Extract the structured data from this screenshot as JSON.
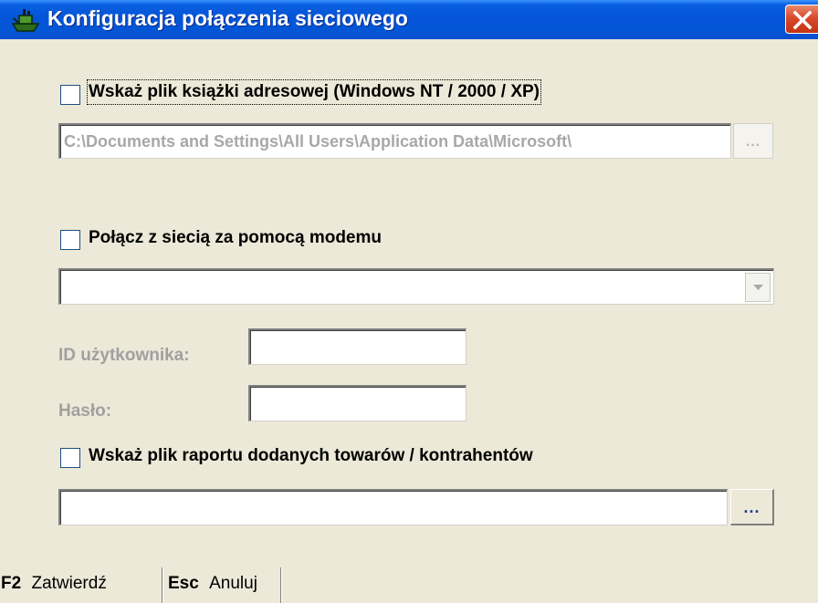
{
  "window": {
    "title": "Konfiguracja połączenia sieciowego",
    "close_glyph": "✕"
  },
  "address_book": {
    "checkbox_label": "Wskaż plik książki adresowej (Windows NT / 2000 / XP)",
    "checked": false,
    "path_value": "C:\\Documents and Settings\\All Users\\Application Data\\Microsoft\\",
    "browse_label": "..."
  },
  "modem": {
    "checkbox_label": "Połącz z siecią za pomocą modemu",
    "checked": false,
    "selected_connection": ""
  },
  "credentials": {
    "user_id_label": "ID użytkownika:",
    "user_id_value": "",
    "password_label": "Hasło:",
    "password_value": ""
  },
  "report": {
    "checkbox_label": "Wskaż plik raportu dodanych towarów / kontrahentów",
    "checked": false,
    "path_value": "",
    "browse_label": "..."
  },
  "statusbar": {
    "confirm_key": "F2",
    "confirm_label": "Zatwierdź",
    "cancel_key": "Esc",
    "cancel_label": "Anuluj"
  },
  "colors": {
    "titlebar": "#0454d8",
    "dialog_bg": "#ece9d8",
    "disabled_text": "#a0a0a0",
    "close_button": "#d9492b",
    "browse_dots_active": "#1f3a8f"
  },
  "icons": {
    "app": "ship-icon",
    "close": "close-icon",
    "dropdown": "chevron-down-icon"
  }
}
